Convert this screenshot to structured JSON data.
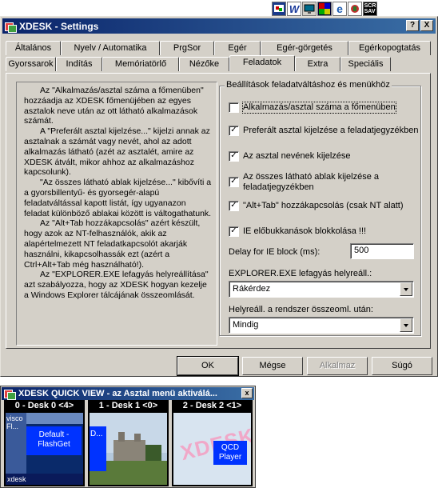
{
  "tray": {
    "icons": [
      "desk-icon",
      "word-icon",
      "monitor-icon",
      "xdesk-icon",
      "ie-icon",
      "media-icon",
      "screensaver-icon"
    ],
    "screensaver_text": "SCR\nSAV"
  },
  "window": {
    "title": "XDESK - Settings",
    "help_label": "?",
    "close_label": "X"
  },
  "tabs": {
    "row1": [
      "Általános",
      "Nyelv / Automatika",
      "PrgSor",
      "Egér",
      "Egér-görgetés",
      "Egérkopogtatás"
    ],
    "row2": [
      "Gyorssarok",
      "Indítás",
      "Memóriatörlő",
      "Nézőke",
      "Feladatok",
      "Extra",
      "Speciális"
    ],
    "active": "Feladatok"
  },
  "description": [
    "Az \"Alkalmazás/asztal száma a főmenüben\" hozzáadja az XDESK főmenüjében az egyes asztalok neve után az ott látható alkalmazások számát.",
    "A \"Preferált asztal kijelzése...\" kijelzi annak az asztalnak a számát vagy nevét, ahol az adott alkalmazás látható (azét az asztalét, amire az XDESK átvált, mikor ahhoz az alkalmazáshoz kapcsolunk).",
    "\"Az összes látható ablak kijelzése...\" kibővíti a a gyorsbillentyű- és gyorsegér-alapú feladatváltással kapott listát, így ugyanazon feladat különböző ablakai között is váltogathatunk.",
    "Az \"Alt+Tab hozzákapcsolás\" azért készült, hogy azok az NT-felhasználók, akik az alapértelmezett NT feladatkapcsolót akarják használni, kikapcsolhassák ezt (azért a Ctrl+Alt+Tab még használható!).",
    "Az \"EXPLORER.EXE lefagyás helyreállítása\" azt szabályozza, hogy az XDESK hogyan kezelje a Windows Explorer tálcájának összeomlását."
  ],
  "group": {
    "title": "Beállítások feladatváltáshoz és menükhöz",
    "options": [
      {
        "label": "Alkalmazás/asztal száma a főmenüben",
        "checked": false
      },
      {
        "label": "Preferált asztal kijelzése a feladatjegyzékben",
        "checked": true
      },
      {
        "label": "Az asztal nevének kijelzése",
        "checked": true
      },
      {
        "label": "Az összes látható ablak kijelzése a feladatjegyzékben",
        "checked": true
      },
      {
        "label": "\"Alt+Tab\" hozzákapcsolás (csak NT alatt)",
        "checked": true
      },
      {
        "label": "IE előbukkanások blokkolása !!!",
        "checked": true
      }
    ],
    "delay_label": "Delay for IE block (ms):",
    "delay_value": "500",
    "explorer_label": "EXPLORER.EXE lefagyás helyreáll.:",
    "explorer_value": "Rákérdez",
    "crash_label": "Helyreáll. a rendszer összeoml. után:",
    "crash_value": "Mindig"
  },
  "buttons": {
    "ok": "OK",
    "cancel": "Mégse",
    "apply": "Alkalmaz",
    "help": "Súgó"
  },
  "quickview": {
    "title": "XDESK QUICK VIEW - az Asztal menü aktiválá...",
    "close_label": "x",
    "desks": [
      {
        "label": "0 - Desk 0 <4>",
        "win_text_a": "visco",
        "win_text_b": "Fl...",
        "popup": "Default - FlashGet",
        "taskbar": "xdesk"
      },
      {
        "label": "1 - Desk 1 <0>",
        "popup": "D..."
      },
      {
        "label": "2 - Desk 2 <1>",
        "logo": "XDESK",
        "popup": "QCD Player"
      }
    ]
  }
}
